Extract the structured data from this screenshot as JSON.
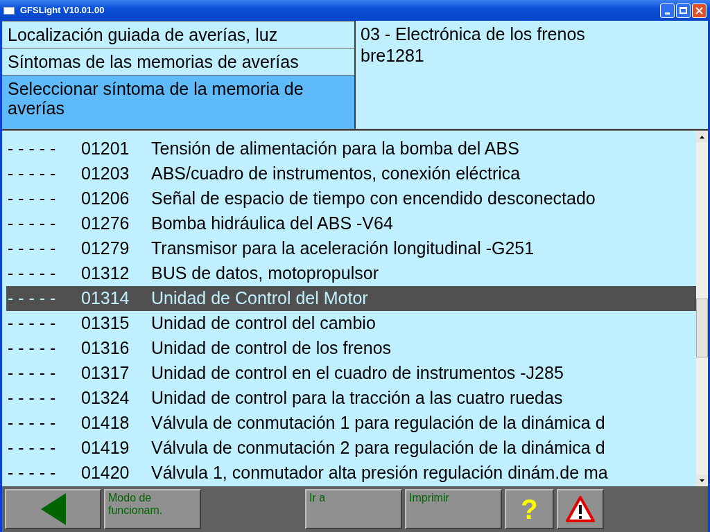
{
  "window": {
    "title": "GFSLight V10.01.00"
  },
  "breadcrumbs": [
    {
      "label": "Localización guiada de averías, luz",
      "selected": false
    },
    {
      "label": "Síntomas de las memorias de averías",
      "selected": false
    },
    {
      "label": "Seleccionar síntoma de la memoria de averías",
      "selected": true
    }
  ],
  "info": {
    "lines": [
      "03 - Electrónica de los frenos",
      "bre1281"
    ]
  },
  "faults": [
    {
      "status": "- - - - -",
      "code": "01201",
      "text": "Tensión de alimentación para la bomba del ABS",
      "selected": false
    },
    {
      "status": "- - - - -",
      "code": "01203",
      "text": "ABS/cuadro de instrumentos, conexión eléctrica",
      "selected": false
    },
    {
      "status": "- - - - -",
      "code": "01206",
      "text": "Señal de espacio de tiempo con encendido desconectado",
      "selected": false
    },
    {
      "status": "- - - - -",
      "code": "01276",
      "text": "Bomba hidráulica del ABS -V64",
      "selected": false
    },
    {
      "status": "- - - - -",
      "code": "01279",
      "text": "Transmisor para la aceleración longitudinal -G251",
      "selected": false
    },
    {
      "status": "- - - - -",
      "code": "01312",
      "text": "BUS de datos, motopropulsor",
      "selected": false
    },
    {
      "status": "- - - - -",
      "code": "01314",
      "text": "Unidad de Control del Motor",
      "selected": true
    },
    {
      "status": "- - - - -",
      "code": "01315",
      "text": "Unidad de control del cambio",
      "selected": false
    },
    {
      "status": "- - - - -",
      "code": "01316",
      "text": "Unidad de control de los frenos",
      "selected": false
    },
    {
      "status": "- - - - -",
      "code": "01317",
      "text": "Unidad de control en el cuadro de instrumentos -J285",
      "selected": false
    },
    {
      "status": "- - - - -",
      "code": "01324",
      "text": "Unidad de control para la tracción a las cuatro ruedas",
      "selected": false
    },
    {
      "status": "- - - - -",
      "code": "01418",
      "text": "Válvula de conmutación 1 para regulación de la dinámica d",
      "selected": false
    },
    {
      "status": "- - - - -",
      "code": "01419",
      "text": "Válvula de conmutación 2 para regulación de la dinámica d",
      "selected": false
    },
    {
      "status": "- - - - -",
      "code": "01420",
      "text": "Válvula 1, conmutador alta presión regulación dinám.de ma",
      "selected": false
    }
  ],
  "toolbar": [
    {
      "kind": "back"
    },
    {
      "kind": "text",
      "label": "Modo de funcionam."
    },
    {
      "kind": "spacer"
    },
    {
      "kind": "text",
      "label": "Ir a"
    },
    {
      "kind": "text",
      "label": "Imprimir"
    },
    {
      "kind": "help",
      "label": "?"
    },
    {
      "kind": "warning"
    }
  ]
}
